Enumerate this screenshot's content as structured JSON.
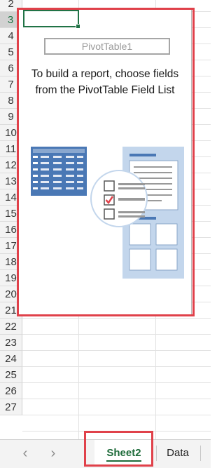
{
  "rows": [
    "2",
    "3",
    "4",
    "5",
    "6",
    "7",
    "8",
    "9",
    "10",
    "11",
    "12",
    "13",
    "14",
    "15",
    "16",
    "17",
    "18",
    "19",
    "20",
    "21",
    "22",
    "23",
    "24",
    "25",
    "26",
    "27"
  ],
  "active_row": "3",
  "pivot": {
    "title": "PivotTable1",
    "instructions_line1": "To build a report, choose fields",
    "instructions_line2": "from the PivotTable Field List"
  },
  "sheets": {
    "tabs": [
      {
        "label": "Sheet2",
        "active": true
      },
      {
        "label": "Data",
        "active": false
      }
    ],
    "prev_icon": "chevron-left-icon",
    "next_icon": "chevron-right-icon"
  },
  "colors": {
    "accent": "#217346",
    "highlight": "#e0414a",
    "illustration_blue": "#4a78b5",
    "illustration_light": "#c3d6ec"
  }
}
